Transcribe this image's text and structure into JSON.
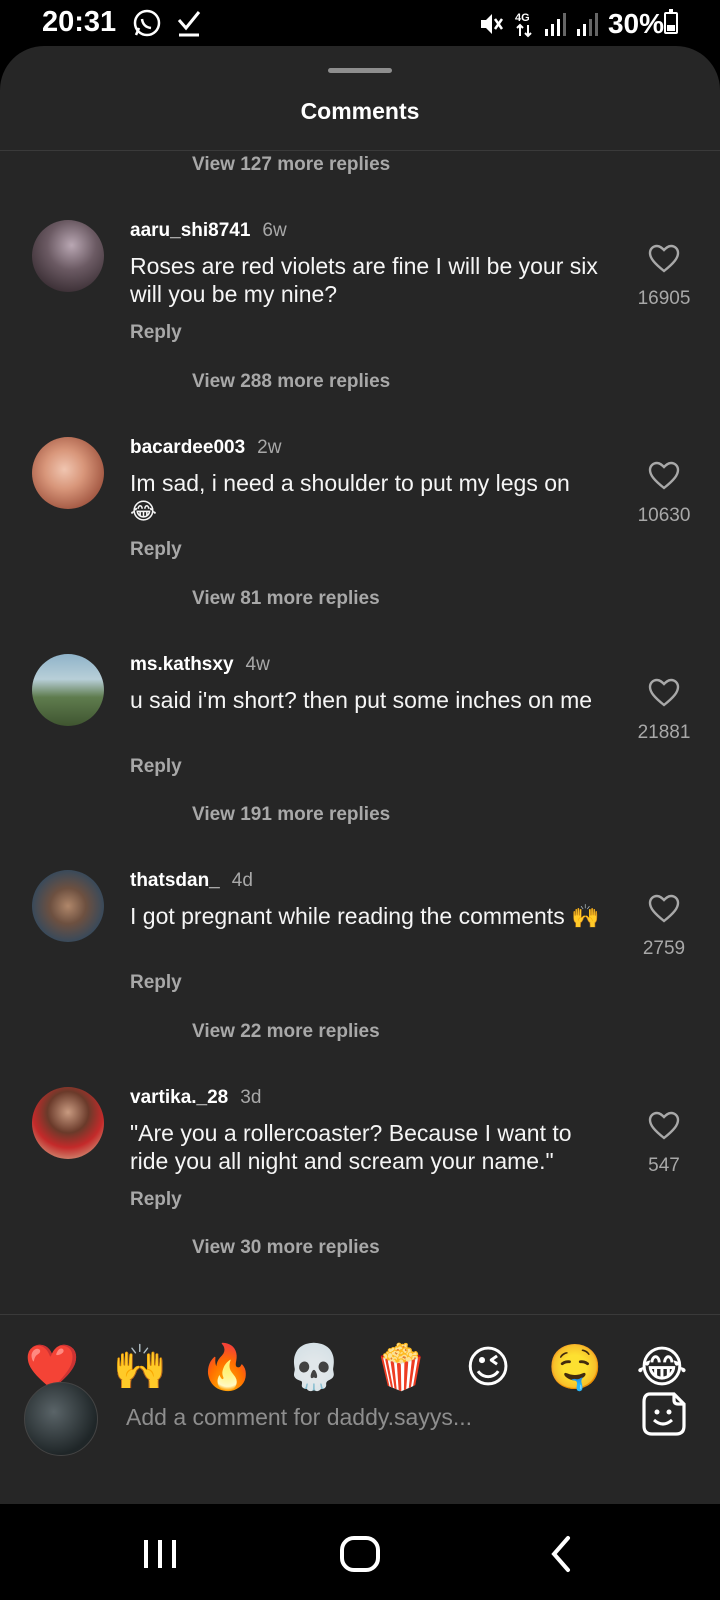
{
  "status": {
    "time": "20:31",
    "battery": "30%",
    "network": "4G"
  },
  "sheet": {
    "title": "Comments",
    "top_view_replies": "View 127 more replies"
  },
  "comments": [
    {
      "username": "aaru_shi8741",
      "age": "6w",
      "text": "Roses are red violets are fine I will be your six will you be my nine?",
      "likes": "16905",
      "reply_label": "Reply",
      "view_replies": "View 288 more replies"
    },
    {
      "username": "bacardee003",
      "age": "2w",
      "text": "Im sad, i need a shoulder to put my legs on 😂",
      "likes": "10630",
      "reply_label": "Reply",
      "view_replies": "View 81 more replies"
    },
    {
      "username": "ms.kathsxy",
      "age": "4w",
      "text": "u said i'm short? then put some inches on me",
      "likes": "21881",
      "reply_label": "Reply",
      "view_replies": "View 191 more replies"
    },
    {
      "username": "thatsdan_",
      "age": "4d",
      "text": "I got pregnant while reading the comments 🙌",
      "likes": "2759",
      "reply_label": "Reply",
      "view_replies": "View 22 more replies"
    },
    {
      "username": "vartika._28",
      "age": "3d",
      "text": "\"Are you a rollercoaster? Because I want to ride you all night and scream your name.\"",
      "likes": "547",
      "reply_label": "Reply",
      "view_replies": "View 30 more replies"
    }
  ],
  "emoji_bar": [
    "❤️",
    "🙌",
    "🔥",
    "💀",
    "🍿",
    "😉",
    "🤤",
    "😂"
  ],
  "composer": {
    "placeholder": "Add a comment for daddy.sayys..."
  },
  "colors": {
    "sheet_bg": "#262626",
    "secondary_text": "#a8a8a8"
  }
}
